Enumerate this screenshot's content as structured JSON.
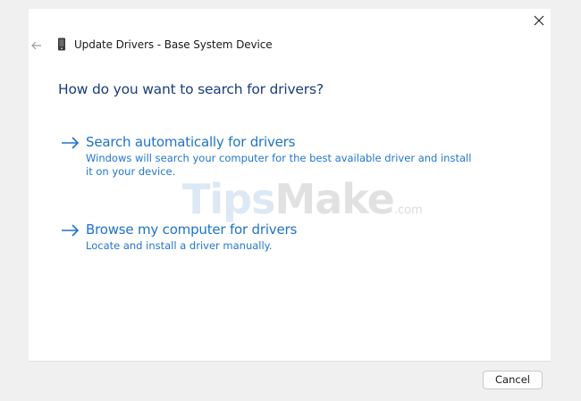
{
  "window": {
    "title": "Update Drivers - Base System Device",
    "back_icon": "arrow-left-icon",
    "device_icon": "device-icon",
    "close_icon": "close-icon"
  },
  "main": {
    "heading": "How do you want to search for drivers?",
    "options": [
      {
        "icon": "arrow-right-icon",
        "title": "Search automatically for drivers",
        "description": "Windows will search your computer for the best available driver and install it on your device."
      },
      {
        "icon": "arrow-right-icon",
        "title": "Browse my computer for drivers",
        "description": "Locate and install a driver manually."
      }
    ]
  },
  "watermark": {
    "part1": "Tips",
    "part2": "Make",
    "suffix": ".com"
  },
  "footer": {
    "cancel_label": "Cancel"
  },
  "colors": {
    "heading": "#1a3d7c",
    "link": "#1e73c8",
    "footer_bg": "#f0f0f0"
  }
}
